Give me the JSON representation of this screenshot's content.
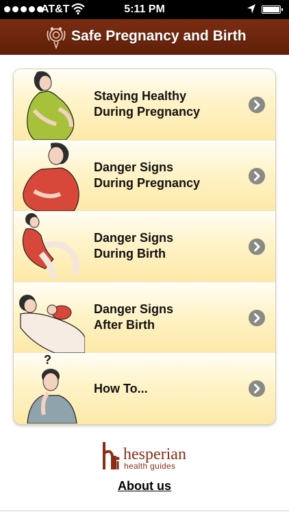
{
  "status_bar": {
    "carrier": "AT&T",
    "time": "5:11 PM"
  },
  "header": {
    "title": "Safe Pregnancy and Birth"
  },
  "menu": {
    "items": [
      {
        "line1": "Staying Healthy",
        "line2": "During Pregnancy",
        "icon": "pregnant-woman-standing"
      },
      {
        "line1": "Danger Signs",
        "line2": "During Pregnancy",
        "icon": "pregnant-woman-worried"
      },
      {
        "line1": "Danger Signs",
        "line2": "During Birth",
        "icon": "woman-giving-birth"
      },
      {
        "line1": "Danger Signs",
        "line2": "After Birth",
        "icon": "mother-with-newborn"
      },
      {
        "line1": "How To...",
        "line2": "",
        "icon": "woman-thinking-question"
      }
    ]
  },
  "footer": {
    "brand_name": "hesperian",
    "brand_tagline": "health guides",
    "about_link": "About us"
  },
  "colors": {
    "header": "#6b250d",
    "item_gradient_top": "#fffef7",
    "item_gradient_bottom": "#fde9a8",
    "chevron": "#8a8a84",
    "brand": "#8a2c17"
  }
}
